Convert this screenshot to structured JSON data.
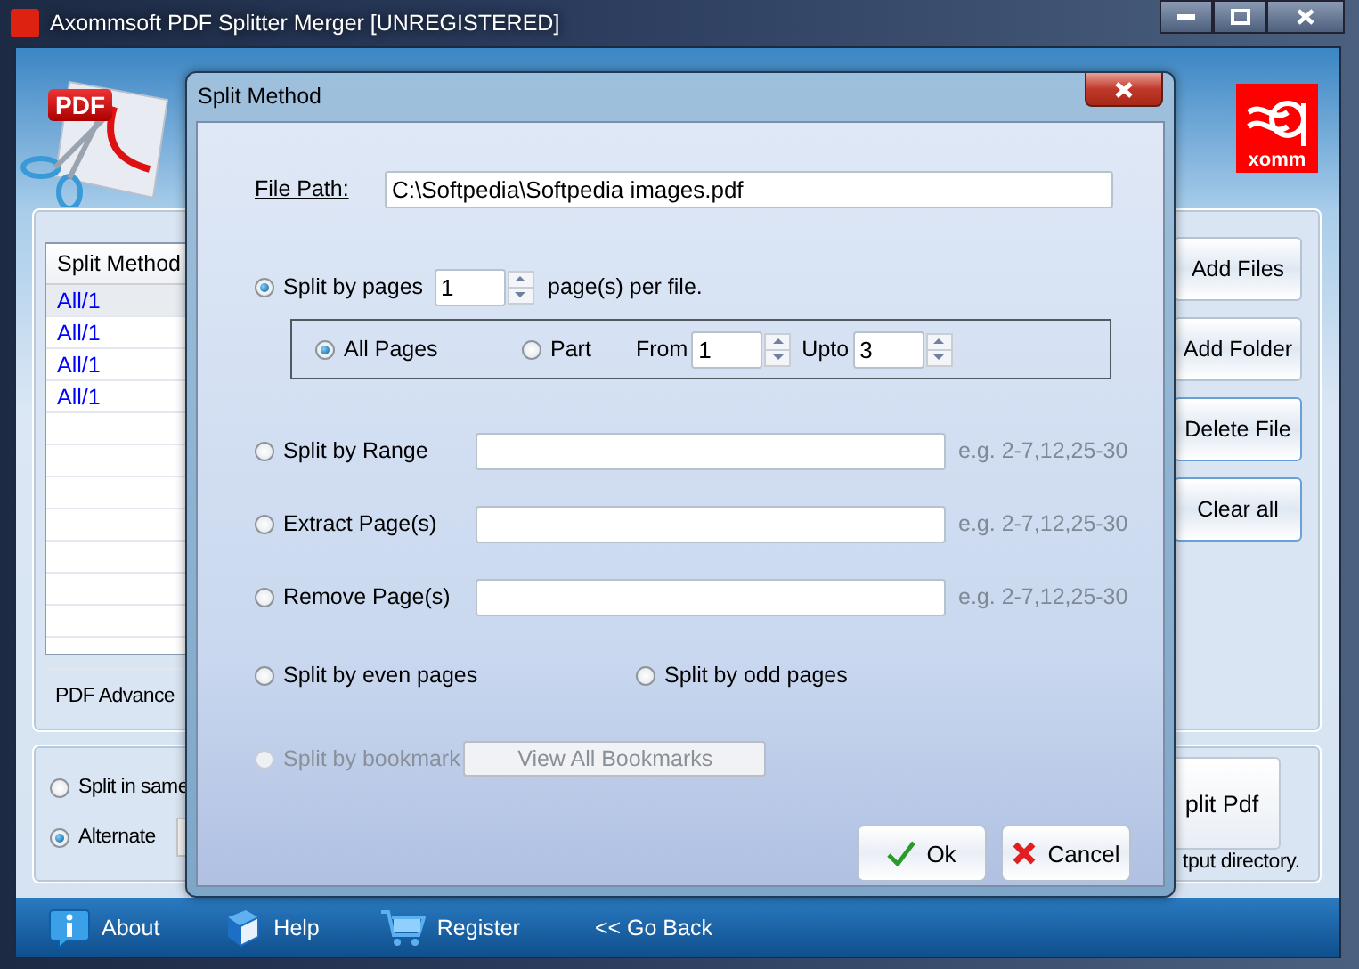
{
  "window": {
    "title": "Axommsoft PDF Splitter Merger [UNREGISTERED]"
  },
  "header": {
    "badge": "PDF",
    "brand": "xomm"
  },
  "file_table": {
    "columns": [
      "Split Method"
    ],
    "rows": [
      {
        "cells": [
          "All/1"
        ],
        "selected": true
      },
      {
        "cells": [
          "All/1"
        ],
        "selected": false
      },
      {
        "cells": [
          "All/1"
        ],
        "selected": false
      },
      {
        "cells": [
          "All/1"
        ],
        "selected": false
      }
    ]
  },
  "options_label": "PDF Advance",
  "actions": [
    "Add Files",
    "Add Folder",
    "Delete File",
    "Clear all"
  ],
  "output": {
    "options": [
      {
        "label": "Split in same",
        "selected": false
      },
      {
        "label": "Alternate",
        "selected": true
      }
    ],
    "split_button": "plit Pdf",
    "note": "tput directory."
  },
  "footer": [
    {
      "label": "About",
      "kind": "info"
    },
    {
      "label": "Help",
      "kind": "help"
    },
    {
      "label": "Register",
      "kind": "cart"
    },
    {
      "label": "<< Go Back",
      "kind": "text"
    }
  ],
  "dialog": {
    "title": "Split Method",
    "file_path": {
      "label": "File Path:",
      "value": "C:\\Softpedia\\Softpedia images.pdf"
    },
    "by_pages": {
      "label": "Split by pages",
      "selected": true,
      "value": "1",
      "suffix": "page(s) per file."
    },
    "page_scope": {
      "options": [
        {
          "label": "All Pages",
          "selected": true
        },
        {
          "label": "Part",
          "selected": false
        }
      ],
      "from_label": "From",
      "from": "1",
      "upto_label": "Upto",
      "upto": "3"
    },
    "methods": [
      {
        "label": "Split by Range",
        "selected": false,
        "example": "e.g. 2-7,12,25-30"
      },
      {
        "label": "Extract Page(s)",
        "selected": false,
        "example": "e.g. 2-7,12,25-30"
      },
      {
        "label": "Remove Page(s)",
        "selected": false,
        "example": "e.g. 2-7,12,25-30"
      }
    ],
    "parity": [
      {
        "label": "Split by even pages",
        "selected": false
      },
      {
        "label": "Split by odd pages",
        "selected": false
      }
    ],
    "bookmark": {
      "label": "Split by bookmark",
      "selected": false,
      "disabled": true,
      "button": "View All Bookmarks"
    },
    "buttons": [
      {
        "label": "Ok",
        "kind": "ok"
      },
      {
        "label": "Cancel",
        "kind": "cancel"
      }
    ]
  }
}
